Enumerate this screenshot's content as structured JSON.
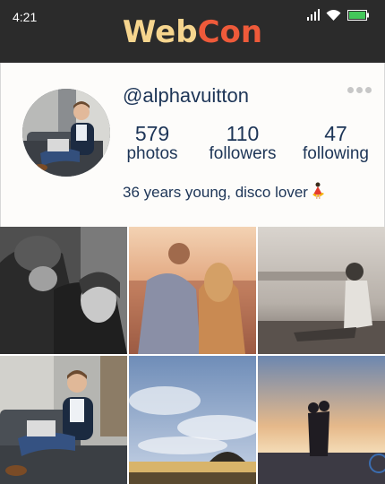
{
  "status_bar": {
    "time": "4:21"
  },
  "app": {
    "title": "WebCon",
    "title_part1": "Web",
    "title_part2": "Con"
  },
  "profile": {
    "username": "@alphavuitton",
    "stats": [
      {
        "value": "579",
        "label": "photos"
      },
      {
        "value": "110",
        "label": "followers"
      },
      {
        "value": "47",
        "label": "following"
      }
    ],
    "bio": "36 years young, disco lover"
  },
  "colors": {
    "appbar": "#2b2b2b",
    "text": "#1d3557",
    "logo_web": "#f6d58e",
    "logo_con": "#ee5a3a"
  },
  "icons": [
    "signal-icon",
    "wifi-icon",
    "battery-icon",
    "more-options-icon",
    "dancer-emoji-icon"
  ]
}
